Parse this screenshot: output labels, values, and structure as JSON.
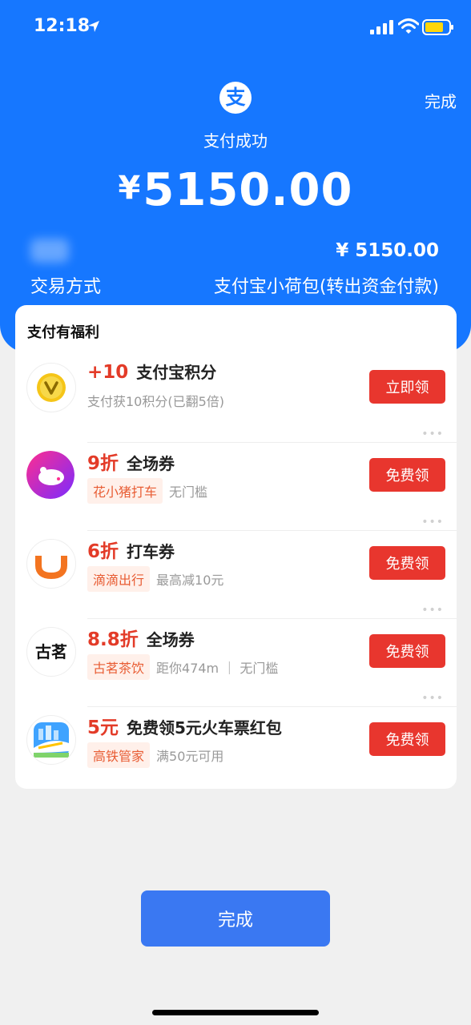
{
  "status_bar": {
    "time": "12:18"
  },
  "header": {
    "done_link": "完成",
    "logo_char": "支",
    "title": "支付成功",
    "currency": "¥",
    "amount": "5150.00",
    "right_amount": "¥ 5150.00",
    "pay_method_label": "交易方式",
    "pay_method_value": "支付宝小荷包(转出资金付款)"
  },
  "benefits": {
    "title": "支付有福利",
    "items": [
      {
        "icon": "points-coin-icon",
        "highlight": "+10",
        "title": "支付宝积分",
        "tag": "",
        "desc": "支付获10积分(已翻5倍)",
        "button": "立即领"
      },
      {
        "icon": "huaxiaozhu-pig-icon",
        "highlight": "9折",
        "title": "全场券",
        "tag": "花小猪打车",
        "desc": "无门槛",
        "button": "免费领"
      },
      {
        "icon": "didi-icon",
        "highlight": "6折",
        "title": "打车券",
        "tag": "滴滴出行",
        "desc": "最高减10元",
        "button": "免费领"
      },
      {
        "icon": "guming-icon",
        "logo_text": "古茗",
        "highlight": "8.8折",
        "title": "全场券",
        "tag": "古茗茶饮",
        "desc": "距你474m ｜ 无门槛",
        "button": "免费领"
      },
      {
        "icon": "high-speed-train-icon",
        "highlight": "5元",
        "title": "免费领5元火车票红包",
        "tag": "高铁管家",
        "desc": "满50元可用",
        "button": "免费领"
      }
    ],
    "more_dots": "•••"
  },
  "footer": {
    "done_button": "完成"
  },
  "colors": {
    "header_blue": "#1677ff",
    "accent_red": "#e8362e",
    "button_blue": "#3a78f2"
  }
}
